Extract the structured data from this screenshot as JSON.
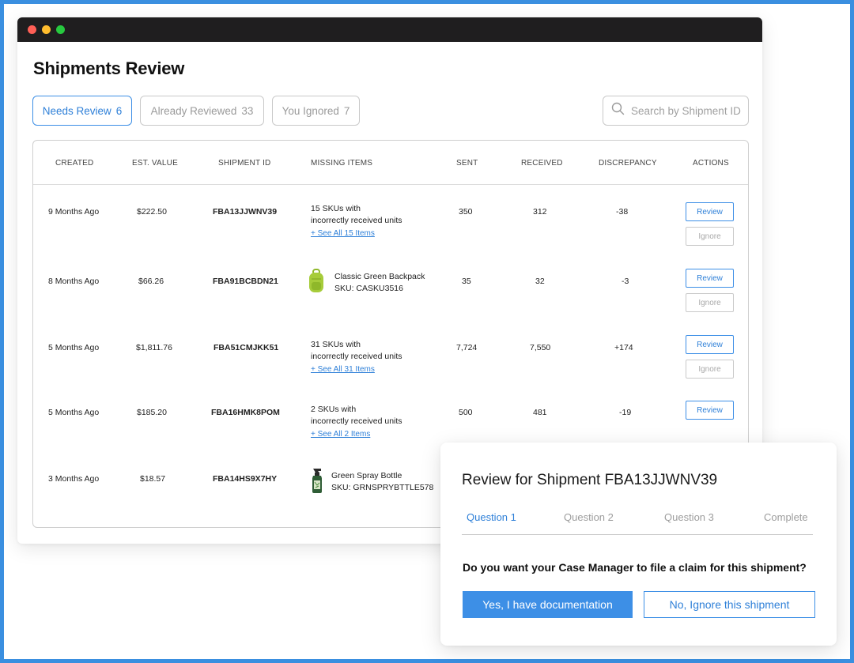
{
  "page": {
    "title": "Shipments Review"
  },
  "tabs": [
    {
      "label": "Needs Review",
      "count": "6"
    },
    {
      "label": "Already Reviewed",
      "count": "33"
    },
    {
      "label": "You Ignored",
      "count": "7"
    }
  ],
  "search": {
    "placeholder": "Search by Shipment ID",
    "icon": "search-icon"
  },
  "table": {
    "columns": [
      "CREATED",
      "EST. VALUE",
      "SHIPMENT ID",
      "MISSING ITEMS",
      "SENT",
      "RECEIVED",
      "DISCREPANCY",
      "ACTIONS"
    ],
    "rows": [
      {
        "created": "9 Months Ago",
        "value": "$222.50",
        "shipment_id": "FBA13JJWNV39",
        "missing_line1": "15 SKUs with",
        "missing_line2": "incorrectly received units",
        "see_all": "+ See All 15 Items",
        "sent": "350",
        "received": "312",
        "discrepancy": "-38",
        "review": "Review",
        "ignore": "Ignore"
      },
      {
        "created": "8 Months Ago",
        "value": "$66.26",
        "shipment_id": "FBA91BCBDN21",
        "item_name": "Classic Green Backpack",
        "item_sku": "SKU: CASKU3516",
        "item_icon": "backpack-icon",
        "sent": "35",
        "received": "32",
        "discrepancy": "-3",
        "review": "Review",
        "ignore": "Ignore"
      },
      {
        "created": "5 Months Ago",
        "value": "$1,811.76",
        "shipment_id": "FBA51CMJKK51",
        "missing_line1": "31 SKUs with",
        "missing_line2": "incorrectly received units",
        "see_all": "+ See All 31 Items",
        "sent": "7,724",
        "received": "7,550",
        "discrepancy": "+174",
        "review": "Review",
        "ignore": "Ignore"
      },
      {
        "created": "5 Months Ago",
        "value": "$185.20",
        "shipment_id": "FBA16HMK8POM",
        "missing_line1": "2 SKUs with",
        "missing_line2": "incorrectly received units",
        "see_all": "+ See All 2 Items",
        "sent": "500",
        "received": "481",
        "discrepancy": "-19",
        "review": "Review"
      },
      {
        "created": "3 Months Ago",
        "value": "$18.57",
        "shipment_id": "FBA14HS9X7HY",
        "item_name": "Green Spray Bottle",
        "item_sku": "SKU: GRNSPRYBTTLE578",
        "item_icon": "spray-bottle-icon"
      }
    ]
  },
  "review_panel": {
    "title": "Review for Shipment FBA13JJWNV39",
    "steps": [
      "Question 1",
      "Question 2",
      "Question 3",
      "Complete"
    ],
    "question": "Do you want your Case Manager to file a claim for this shipment?",
    "yes_label": "Yes, I have documentation",
    "no_label": "No, Ignore this shipment"
  },
  "colors": {
    "accent": "#3d8fe6",
    "frame_border": "#3a8fe0",
    "titlebar": "#1f1e1f"
  }
}
